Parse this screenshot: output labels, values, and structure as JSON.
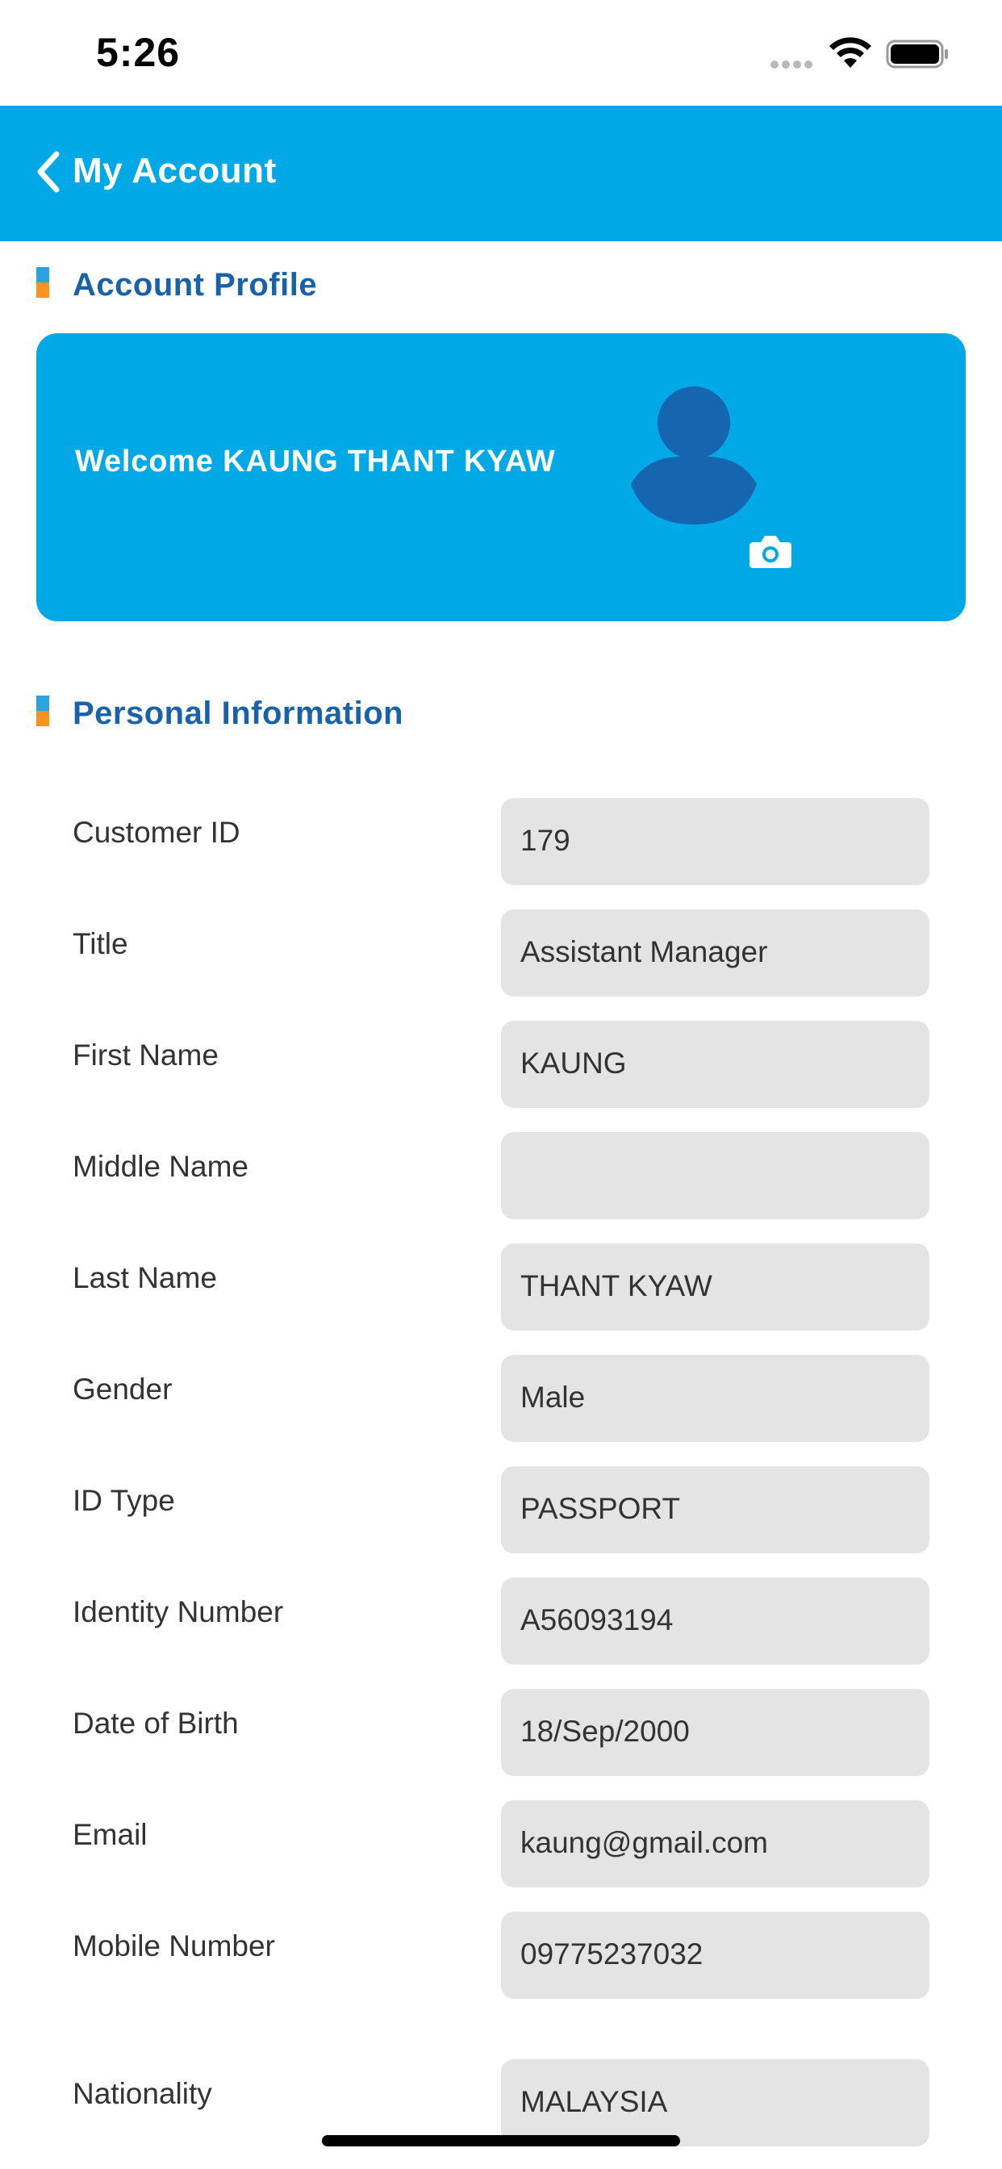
{
  "status_bar": {
    "time": "5:26"
  },
  "nav": {
    "title": "My Account",
    "back_icon": "chevron-left-icon"
  },
  "colors": {
    "primary": "#00a8e6",
    "section_title": "#1a62a8",
    "accent_orange": "#f7931e",
    "field_bg": "#e4e4e4"
  },
  "account_profile": {
    "section_title": "Account Profile",
    "welcome_text": "Welcome KAUNG THANT KYAW",
    "avatar_icon": "user-avatar-icon",
    "camera_icon": "camera-icon"
  },
  "personal_info": {
    "section_title": "Personal Information",
    "fields": [
      {
        "label": "Customer ID",
        "value": "179"
      },
      {
        "label": "Title",
        "value": "Assistant Manager"
      },
      {
        "label": "First Name",
        "value": "KAUNG"
      },
      {
        "label": "Middle Name",
        "value": ""
      },
      {
        "label": "Last Name",
        "value": "THANT KYAW"
      },
      {
        "label": "Gender",
        "value": "Male"
      },
      {
        "label": "ID Type",
        "value": "PASSPORT"
      },
      {
        "label": "Identity Number",
        "value": "A56093194"
      },
      {
        "label": "Date of Birth",
        "value": "18/Sep/2000"
      },
      {
        "label": "Email",
        "value": "kaung@gmail.com"
      },
      {
        "label": "Mobile Number",
        "value": "09775237032"
      },
      {
        "label": "Nationality",
        "value": "MALAYSIA"
      }
    ]
  }
}
